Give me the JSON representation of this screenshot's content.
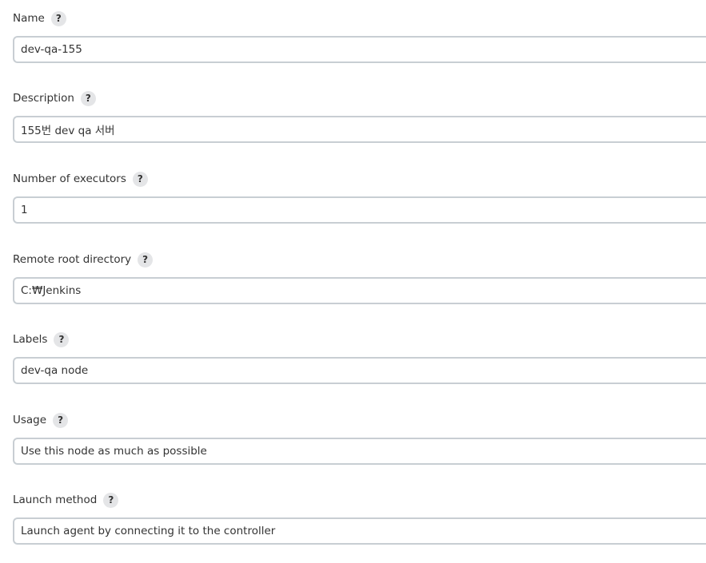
{
  "fields": [
    {
      "label": "Name",
      "value": "dev-qa-155"
    },
    {
      "label": "Description",
      "value": "155번 dev qa 서버"
    },
    {
      "label": "Number of executors",
      "value": "1"
    },
    {
      "label": "Remote root directory",
      "value": "C:₩Jenkins"
    },
    {
      "label": "Labels",
      "value": "dev-qa node"
    },
    {
      "label": "Usage",
      "value": "Use this node as much as possible"
    },
    {
      "label": "Launch method",
      "value": "Launch agent by connecting it to the controller"
    }
  ],
  "help_glyph": "?",
  "icons": {
    "help": "help-icon"
  }
}
